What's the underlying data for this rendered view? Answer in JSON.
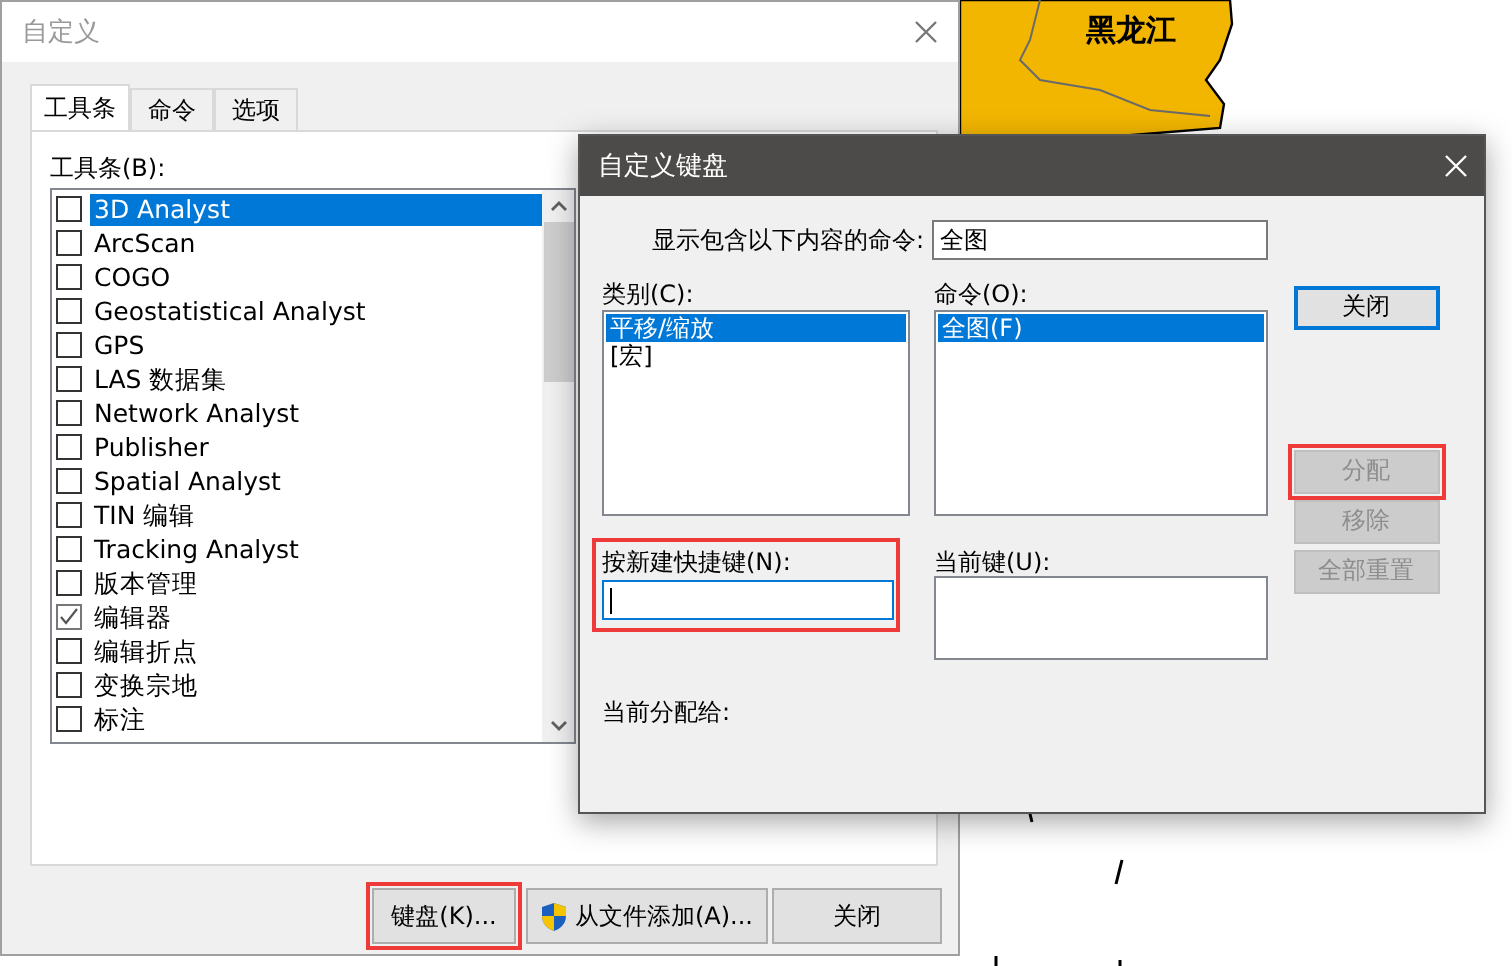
{
  "map": {
    "labels": [
      "黑龙江"
    ]
  },
  "customize_dialog": {
    "title": "自定义",
    "tabs": [
      {
        "label": "工具条",
        "selected": true
      },
      {
        "label": "命令",
        "selected": false
      },
      {
        "label": "选项",
        "selected": false
      }
    ],
    "toolbars_label": "工具条(B):",
    "toolbars": [
      {
        "label": "3D Analyst",
        "checked": false,
        "selected": true
      },
      {
        "label": "ArcScan",
        "checked": false,
        "selected": false
      },
      {
        "label": "COGO",
        "checked": false,
        "selected": false
      },
      {
        "label": "Geostatistical Analyst",
        "checked": false,
        "selected": false
      },
      {
        "label": "GPS",
        "checked": false,
        "selected": false
      },
      {
        "label": "LAS 数据集",
        "checked": false,
        "selected": false
      },
      {
        "label": "Network Analyst",
        "checked": false,
        "selected": false
      },
      {
        "label": "Publisher",
        "checked": false,
        "selected": false
      },
      {
        "label": "Spatial Analyst",
        "checked": false,
        "selected": false
      },
      {
        "label": "TIN 编辑",
        "checked": false,
        "selected": false
      },
      {
        "label": "Tracking Analyst",
        "checked": false,
        "selected": false
      },
      {
        "label": "版本管理",
        "checked": false,
        "selected": false
      },
      {
        "label": "编辑器",
        "checked": true,
        "selected": false
      },
      {
        "label": "编辑折点",
        "checked": false,
        "selected": false
      },
      {
        "label": "变换宗地",
        "checked": false,
        "selected": false
      },
      {
        "label": "标注",
        "checked": false,
        "selected": false
      }
    ],
    "buttons": [
      {
        "label": "键盘(K)...",
        "kind": "plain",
        "highlighted": true
      },
      {
        "label": "从文件添加(A)...",
        "kind": "shield",
        "highlighted": false
      },
      {
        "label": "关闭",
        "kind": "plain",
        "highlighted": false
      }
    ]
  },
  "keyboard_dialog": {
    "title": "自定义键盘",
    "filter_label": "显示包含以下内容的命令:",
    "filter_value": "全图",
    "categories_label": "类别(C):",
    "categories": [
      {
        "label": "平移/缩放",
        "selected": true
      },
      {
        "label": "[宏]",
        "selected": false
      }
    ],
    "commands_label": "命令(O):",
    "commands": [
      {
        "label": "全图(F)",
        "selected": true
      }
    ],
    "new_shortcut": {
      "label": "按新建快捷键(N):",
      "focused": true,
      "highlighted": true
    },
    "current_keys_label": "当前键(U):",
    "assigned_to_label": "当前分配给:",
    "buttons": [
      {
        "label": "关闭",
        "disabled": false,
        "default": true,
        "highlighted": false
      },
      {
        "label": "分配",
        "disabled": true,
        "default": false,
        "highlighted": true
      },
      {
        "label": "移除",
        "disabled": true,
        "default": false,
        "highlighted": false
      },
      {
        "label": "全部重置",
        "disabled": true,
        "default": false,
        "highlighted": false
      }
    ]
  }
}
